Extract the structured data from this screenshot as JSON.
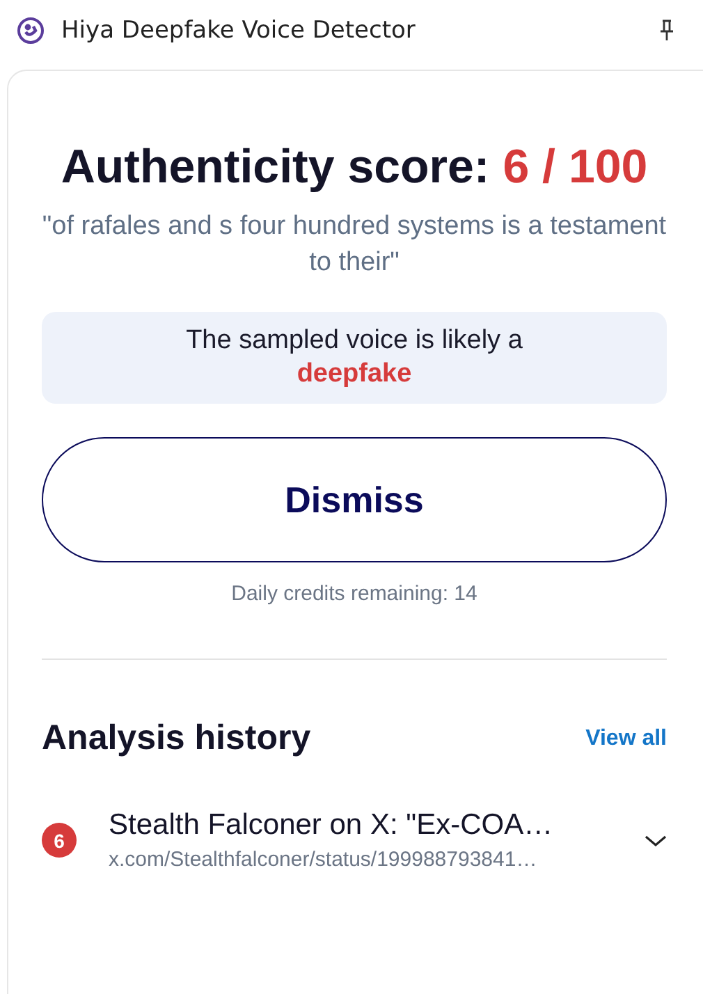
{
  "window": {
    "title": "Hiya Deepfake Voice Detector"
  },
  "result": {
    "score_label": "Authenticity score:",
    "score_value": "6 / 100",
    "quote": "\"of rafales and s four hundred systems is a testament to their\"",
    "verdict_text": "The sampled voice is likely a",
    "verdict": "deepfake",
    "dismiss": "Dismiss",
    "credits": "Daily credits remaining: 14"
  },
  "history": {
    "title": "Analysis history",
    "view_all": "View all",
    "items": [
      {
        "score": "6",
        "color": "#d63b3b",
        "title": "Stealth Falconer on X: \"Ex-COA…",
        "url": "x.com/Stealthfalconer/status/199988793841…",
        "expanded": false
      }
    ]
  }
}
